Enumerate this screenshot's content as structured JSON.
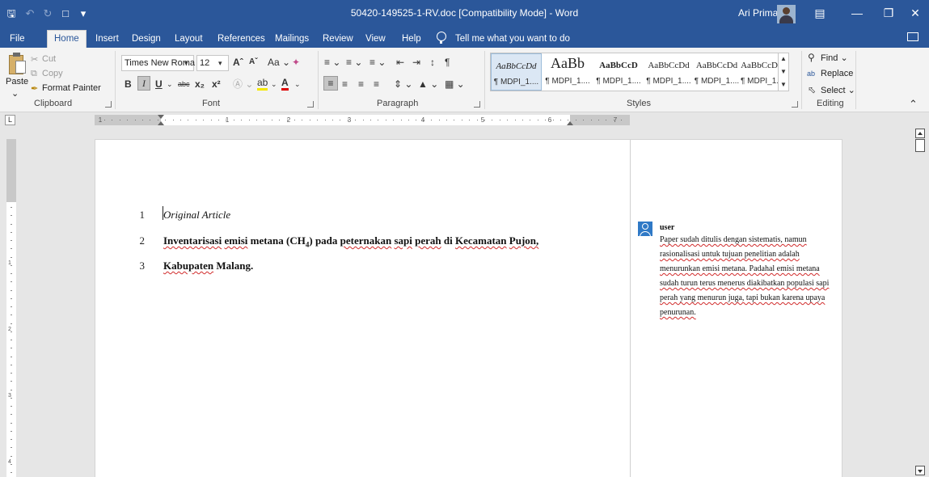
{
  "titlebar": {
    "document_title": "50420-149525-1-RV.doc [Compatibility Mode]  -  Word",
    "user_name": "Ari Prima",
    "icons": [
      "save-icon",
      "undo-icon",
      "redo-icon",
      "new-document-icon",
      "customize-qat-icon",
      "ribbon-display-options-icon",
      "minimize-icon",
      "restore-icon",
      "close-icon"
    ]
  },
  "tabs": [
    "File",
    "Home",
    "Insert",
    "Design",
    "Layout",
    "References",
    "Mailings",
    "Review",
    "View",
    "Help"
  ],
  "active_tab": "Home",
  "tell_me": "Tell me what you want to do",
  "ribbon": {
    "clipboard": {
      "label": "Clipboard",
      "paste": "Paste",
      "cut": "Cut",
      "copy": "Copy",
      "format_painter": "Format Painter"
    },
    "font": {
      "label": "Font",
      "font_name": "Times New Roma",
      "font_size": "12",
      "change_case": "Aa"
    },
    "paragraph": {
      "label": "Paragraph"
    },
    "styles": {
      "label": "Styles",
      "gallery": [
        {
          "sample": "AaBbCcDd",
          "name": "¶ MDPI_1...."
        },
        {
          "sample": "AaBb",
          "name": "¶ MDPI_1...."
        },
        {
          "sample": "AaBbCcD",
          "name": "¶ MDPI_1...."
        },
        {
          "sample": "AaBbCcDd",
          "name": "¶ MDPI_1...."
        },
        {
          "sample": "AaBbCcDd",
          "name": "¶ MDPI_1...."
        },
        {
          "sample": "AaBbCcD",
          "name": "¶ MDPI_1...."
        }
      ]
    },
    "editing": {
      "label": "Editing",
      "find": "Find",
      "replace": "Replace",
      "select": "Select"
    }
  },
  "ruler": {
    "numbers": [
      "1",
      "1",
      "2",
      "3",
      "4",
      "5",
      "6",
      "7"
    ]
  },
  "vruler": {
    "numbers": [
      "1",
      "2",
      "3",
      "4"
    ]
  },
  "document": {
    "lines": [
      {
        "num": "1",
        "segments": [
          {
            "text": "Original Article",
            "sq": false
          }
        ]
      },
      {
        "num": "2",
        "segments": [
          {
            "text": "Inventarisasi",
            "sq": true
          },
          {
            "text": " ",
            "sq": false
          },
          {
            "text": "emisi",
            "sq": true
          },
          {
            "text": " metana (CH",
            "sq": false
          },
          {
            "text": "4",
            "sq": false,
            "sub": true
          },
          {
            "text": ") pada ",
            "sq": false
          },
          {
            "text": "peternakan",
            "sq": true
          },
          {
            "text": " ",
            "sq": false
          },
          {
            "text": "sapi",
            "sq": true
          },
          {
            "text": " ",
            "sq": false
          },
          {
            "text": "perah",
            "sq": true
          },
          {
            "text": " di ",
            "sq": false
          },
          {
            "text": "Kecamatan",
            "sq": true
          },
          {
            "text": " ",
            "sq": false
          },
          {
            "text": "Pujon,",
            "sq": true
          }
        ]
      },
      {
        "num": "3",
        "segments": [
          {
            "text": "Kabupaten",
            "sq": true
          },
          {
            "text": " Malang.",
            "sq": false
          }
        ]
      }
    ]
  },
  "comment": {
    "author": "user",
    "lines": [
      "Paper sudah ditulis dengan sistematis, namun",
      "rasionalisasi untuk tujuan penelitian adalah",
      "menurunkan emisi metana. Padahal emisi metana",
      "sudah turun terus menerus diakibatkan populasi sapi",
      "perah yang menurun juga, tapi bukan karena upaya",
      "penurunan."
    ]
  }
}
